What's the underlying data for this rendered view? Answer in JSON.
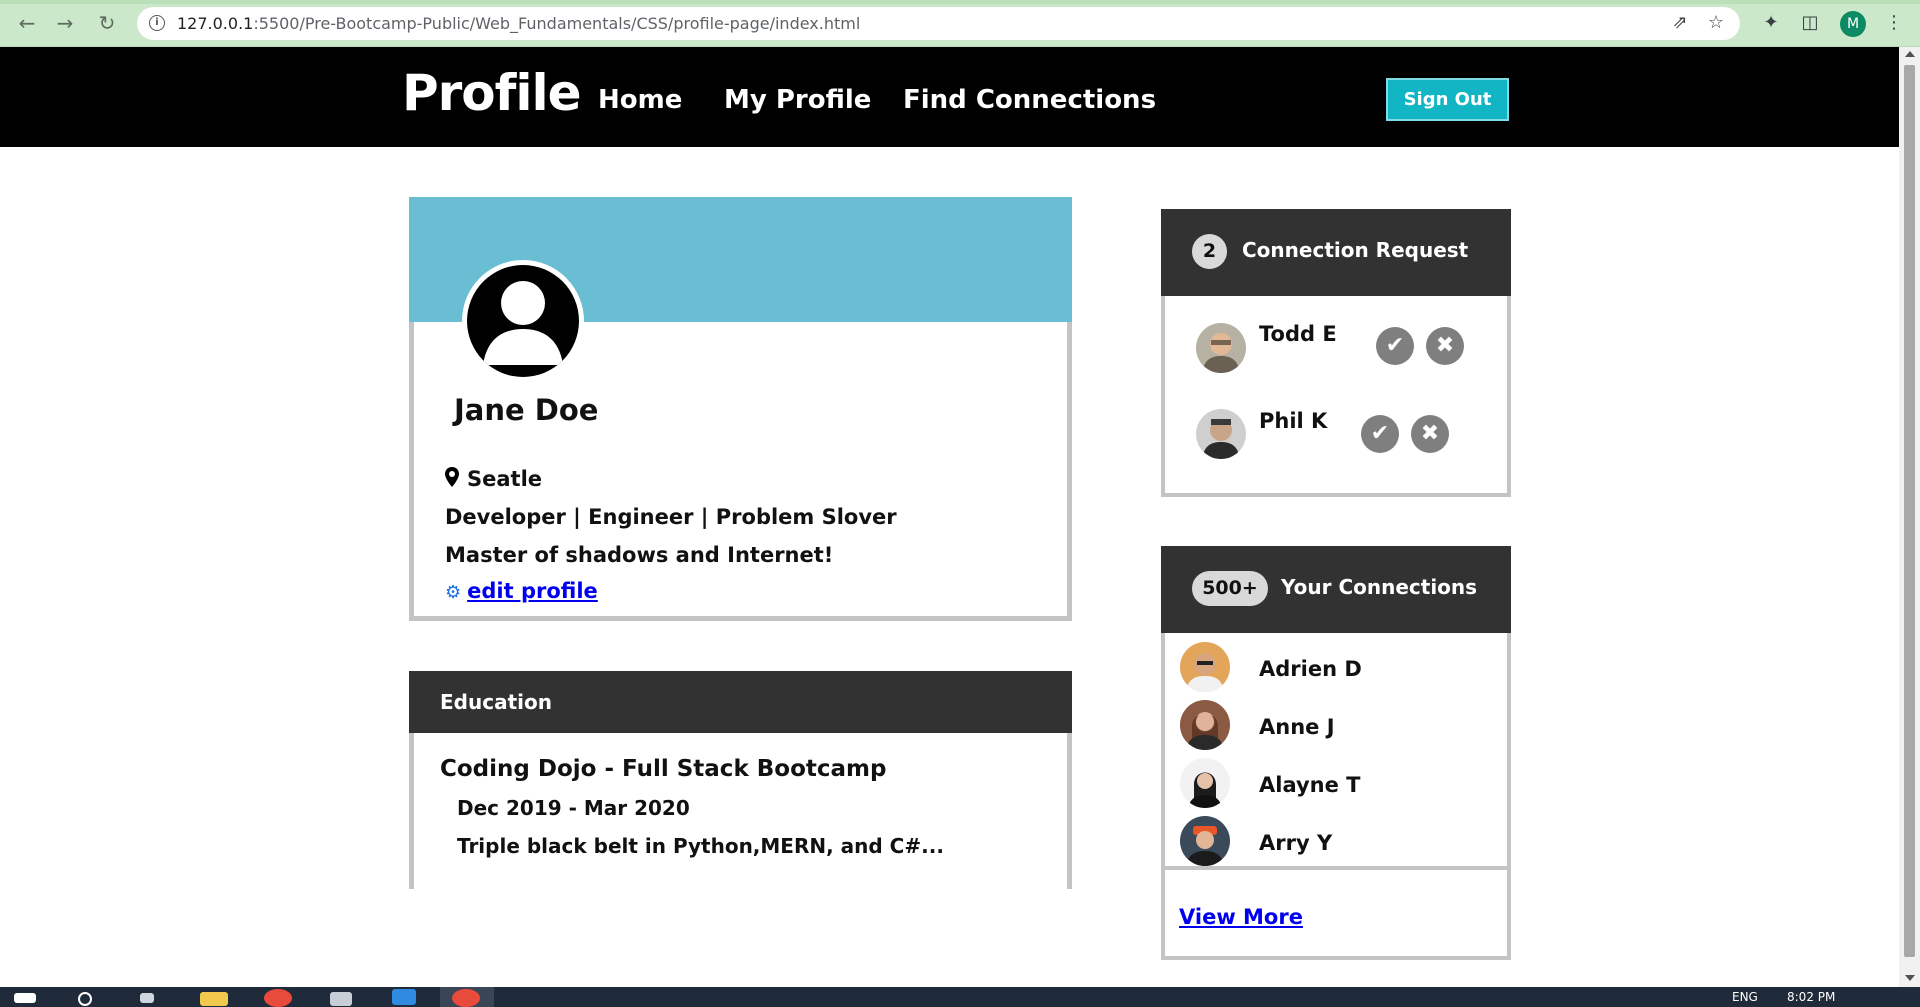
{
  "browser": {
    "url_host": "127.0.0.1",
    "url_path": ":5500/Pre-Bootcamp-Public/Web_Fundamentals/CSS/profile-page/index.html",
    "profile_initial": "M"
  },
  "header": {
    "brand": "Profile",
    "nav": [
      "Home",
      "My Profile",
      "Find Connections"
    ],
    "signout": "Sign Out"
  },
  "profile": {
    "name": "Jane Doe",
    "location": "Seatle",
    "tagline": "Developer | Engineer | Problem Slover",
    "bio": "Master of shadows and Internet!",
    "edit_link": "edit profile"
  },
  "education": {
    "heading": "Education",
    "school": "Coding Dojo - Full Stack Bootcamp",
    "dates": "Dec 2019 - Mar 2020",
    "details": "Triple black belt in Python,MERN, and C#..."
  },
  "requests": {
    "count": "2",
    "heading": "Connection Request",
    "people": [
      "Todd E",
      "Phil K"
    ]
  },
  "connections": {
    "count": "500+",
    "heading": "Your Connections",
    "people": [
      "Adrien D",
      "Anne J",
      "Alayne T",
      "Arry Y"
    ],
    "view_more": "View More"
  },
  "taskbar": {
    "lang": "ENG",
    "time": "8:02 PM"
  },
  "colors": {
    "banner": "#69bed4",
    "signout_bg": "#12b5c4",
    "card_header": "#323232"
  }
}
